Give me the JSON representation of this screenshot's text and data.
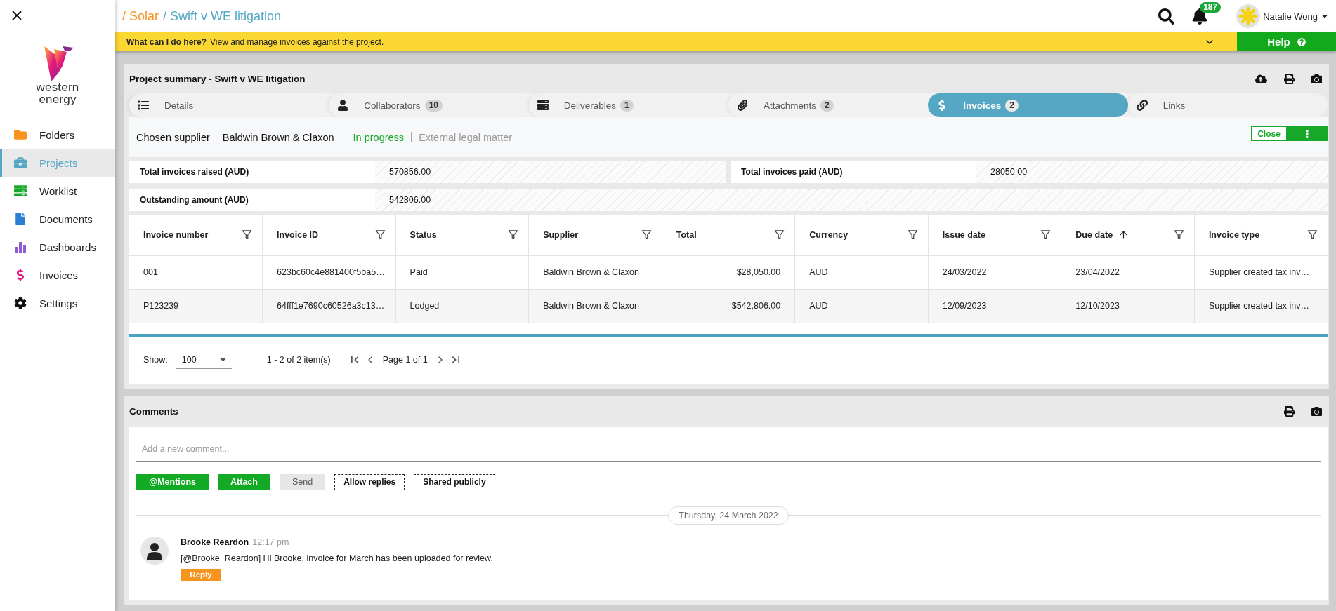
{
  "sidebar": {
    "logo": {
      "line_1": "western",
      "line_2": "energy"
    },
    "items": [
      {
        "label": "Folders",
        "selected": false
      },
      {
        "label": "Projects",
        "selected": true
      },
      {
        "label": "Worklist",
        "selected": false
      },
      {
        "label": "Documents",
        "selected": false
      },
      {
        "label": "Dashboards",
        "selected": false
      },
      {
        "label": "Invoices",
        "selected": false
      },
      {
        "label": "Settings",
        "selected": false
      }
    ]
  },
  "header": {
    "breadcrumb": [
      {
        "label": "/ Solar",
        "current": false
      },
      {
        "label": "/ Swift v WE litigation",
        "current": true
      }
    ],
    "notification_count": "187",
    "user_name": "Natalie Wong"
  },
  "help_bar": {
    "question": "What can I do here?",
    "text": "View and manage invoices against the project.",
    "help_button": "Help"
  },
  "project_panel": {
    "title": "Project summary - Swift v WE litigation",
    "tabs": [
      {
        "label": "Details",
        "selected": false
      },
      {
        "label": "Collaborators",
        "count": "10",
        "selected": false
      },
      {
        "label": "Deliverables",
        "count": "1",
        "selected": false
      },
      {
        "label": "Attachments",
        "count": "2",
        "selected": false
      },
      {
        "label": "Invoices",
        "count": "2",
        "selected": true
      },
      {
        "label": "Links",
        "selected": false
      }
    ],
    "supplier": {
      "label": "Chosen supplier",
      "name": "Baldwin Brown & Claxon",
      "status": "In progress",
      "matter_type": "External legal matter"
    },
    "close_button": "Close",
    "total_rows": [
      {
        "cells": [
          {
            "label": "Total invoices raised (AUD)",
            "value": "570856.00"
          },
          {
            "label": "Total invoices paid (AUD)",
            "value": "28050.00"
          }
        ]
      },
      {
        "cells": [
          {
            "label": "Outstanding amount (AUD)",
            "value": "542806.00"
          }
        ]
      }
    ],
    "table": {
      "columns": [
        {
          "label": "Invoice number",
          "kind": "text",
          "sorted_ascending": false
        },
        {
          "label": "Invoice ID",
          "kind": "text",
          "sorted_ascending": false
        },
        {
          "label": "Status",
          "kind": "text",
          "sorted_ascending": false
        },
        {
          "label": "Supplier",
          "kind": "text",
          "sorted_ascending": false
        },
        {
          "label": "Total",
          "kind": "amount",
          "sorted_ascending": false
        },
        {
          "label": "Currency",
          "kind": "text",
          "sorted_ascending": false
        },
        {
          "label": "Issue date",
          "kind": "text",
          "sorted_ascending": false
        },
        {
          "label": "Due date",
          "kind": "text",
          "sorted_ascending": true
        },
        {
          "label": "Invoice type",
          "kind": "text",
          "sorted_ascending": false
        }
      ],
      "rows": [
        {
          "cells": [
            "001",
            "623bc60c4e881400f5ba5…",
            "Paid",
            "Baldwin Brown & Claxon",
            "$28,050.00",
            "AUD",
            "24/03/2022",
            "23/04/2022",
            "Supplier created tax inv…"
          ]
        },
        {
          "cells": [
            "P123239",
            "64fff1e7690c60526a3c13…",
            "Lodged",
            "Baldwin Brown & Claxon",
            "$542,806.00",
            "AUD",
            "12/09/2023",
            "12/10/2023",
            "Supplier created tax inv…"
          ]
        }
      ]
    },
    "pager": {
      "show_label": "Show:",
      "page_size": "100",
      "range": "1 - 2 of 2 item(s)",
      "page": "Page 1 of 1"
    }
  },
  "comments_panel": {
    "title": "Comments",
    "placeholder": "Add a new comment...",
    "actions": [
      {
        "label": "@Mentions",
        "disabled": false
      },
      {
        "label": "Attach",
        "disabled": false
      },
      {
        "label": "Send",
        "disabled": true
      }
    ],
    "toggles": [
      {
        "label": "Allow replies"
      },
      {
        "label": "Shared publicly"
      }
    ],
    "date_divider": "Thursday, 24 March 2022",
    "comments": [
      {
        "author": "Brooke Reardon",
        "time": "12:17 pm",
        "text": "[@Brooke_Reardon] Hi Brooke, invoice for March has been uploaded for review.",
        "reply_button": "Reply"
      }
    ]
  }
}
